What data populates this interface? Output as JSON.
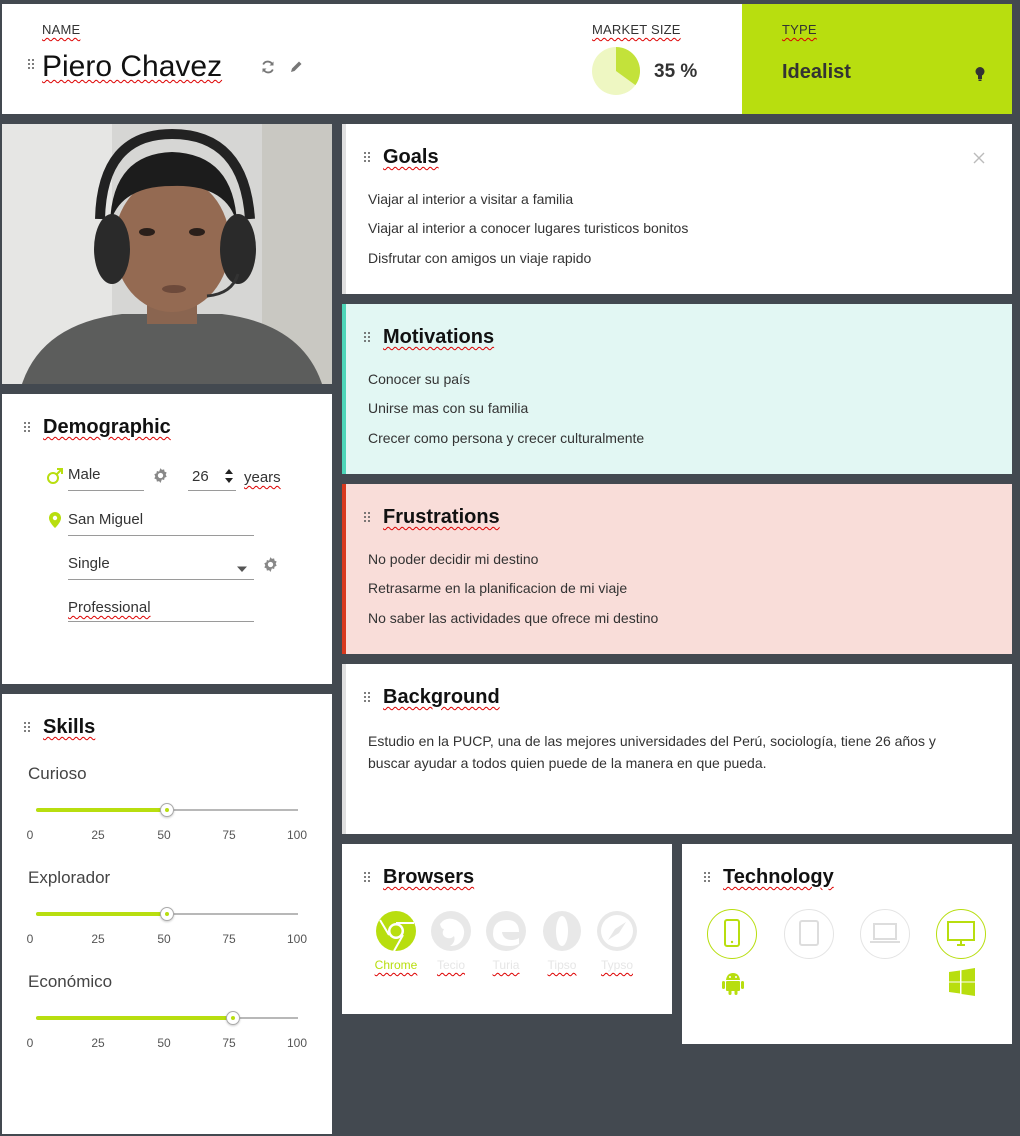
{
  "header": {
    "name_label": "NAME",
    "name": "Piero Chavez",
    "refresh_icon": "refresh-icon",
    "edit_icon": "pencil-icon",
    "market_label": "MARKET SIZE",
    "market_value": "35 %",
    "market_fraction": 0.35,
    "type_label": "TYPE",
    "type_value": "Idealist",
    "type_icon": "lightbulb-icon"
  },
  "colors": {
    "accent": "#b8de0f",
    "background": "#434950",
    "motivations_bg": "#e2f7f3",
    "motivations_bar": "#4dd6b8",
    "frustrations_bg": "#f9ddd9",
    "frustrations_bar": "#d8391e"
  },
  "demographic": {
    "title": "Demographic",
    "gender": "Male",
    "age": "26",
    "years_label": "years",
    "location": "San Miguel",
    "status": "Single",
    "occupation": "Professional"
  },
  "skills": {
    "title": "Skills",
    "ticks": [
      "0",
      "25",
      "50",
      "75",
      "100"
    ],
    "items": [
      {
        "label": "Curioso",
        "value": 50
      },
      {
        "label": "Explorador",
        "value": 50
      },
      {
        "label": "Económico",
        "value": 75
      }
    ]
  },
  "goals": {
    "title": "Goals",
    "items": [
      "Viajar al interior a visitar a familia",
      "Viajar al interior a conocer lugares turisticos bonitos",
      "Disfrutar con amigos un viaje rapido"
    ]
  },
  "motivations": {
    "title": "Motivations",
    "items": [
      "Conocer su país",
      "Unirse mas con su familia",
      "Crecer como persona y crecer culturalmente"
    ]
  },
  "frustrations": {
    "title": "Frustrations",
    "items": [
      "No poder decidir mi destino",
      "Retrasarme en la planificacion de mi viaje",
      "No saber las actividades que ofrece mi destino"
    ]
  },
  "background": {
    "title": "Background",
    "text": "Estudio en la PUCP, una de las mejores universidades del Perú, sociología, tiene 26 años y buscar ayudar a todos quien puede de la manera en que pueda."
  },
  "browsers": {
    "title": "Browsers",
    "items": [
      {
        "icon": "chrome-icon",
        "label": "Chrome",
        "active": true
      },
      {
        "icon": "firefox-icon",
        "label": "Tecio",
        "active": false
      },
      {
        "icon": "edge-icon",
        "label": "Turia",
        "active": false
      },
      {
        "icon": "opera-icon",
        "label": "Tipso",
        "active": false
      },
      {
        "icon": "safari-icon",
        "label": "Typso",
        "active": false
      }
    ]
  },
  "technology": {
    "title": "Technology",
    "devices": [
      {
        "icon": "smartphone-icon",
        "active": true
      },
      {
        "icon": "tablet-icon",
        "active": false
      },
      {
        "icon": "laptop-icon",
        "active": false
      },
      {
        "icon": "desktop-icon",
        "active": true
      }
    ],
    "os": [
      "android-icon",
      "windows-icon"
    ]
  }
}
